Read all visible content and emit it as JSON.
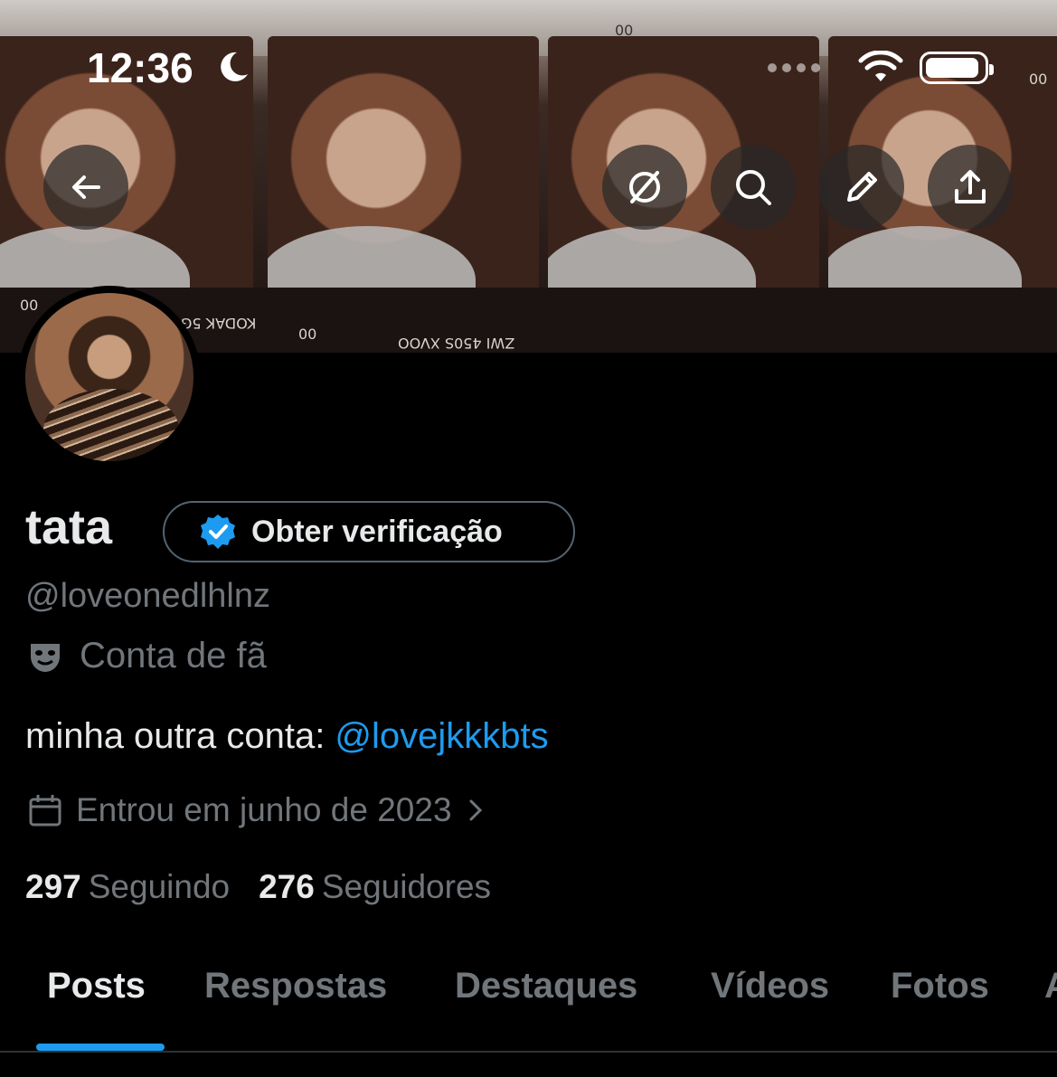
{
  "status_bar": {
    "time": "12:36",
    "icons": [
      "moon-icon",
      "signal-dots-icon",
      "wifi-icon",
      "battery-icon"
    ]
  },
  "banner": {
    "film_labels": [
      "00",
      "00",
      "KODAK 5G",
      "00",
      "ZWI 450S XVOO",
      "00",
      "00",
      "00"
    ]
  },
  "header_buttons": {
    "back": "back-arrow-icon",
    "grok": "grok-icon",
    "search": "search-icon",
    "edit": "pencil-icon",
    "share": "share-icon"
  },
  "profile": {
    "name": "tata",
    "verify_label": "Obter verificação",
    "handle": "@loveonedlhlnz",
    "category": "Conta de fã",
    "bio_text": "minha outra conta: ",
    "bio_link": "@lovejkkkbts",
    "joined": "Entrou em junho de 2023",
    "following_count": "297",
    "following_label": "Seguindo",
    "followers_count": "276",
    "followers_label": "Seguidores"
  },
  "tabs": [
    "Posts",
    "Respostas",
    "Destaques",
    "Vídeos",
    "Fotos",
    "A"
  ],
  "colors": {
    "accent": "#1d9bf0",
    "muted": "#71767b",
    "text": "#e7e9ea",
    "background": "#000000"
  }
}
